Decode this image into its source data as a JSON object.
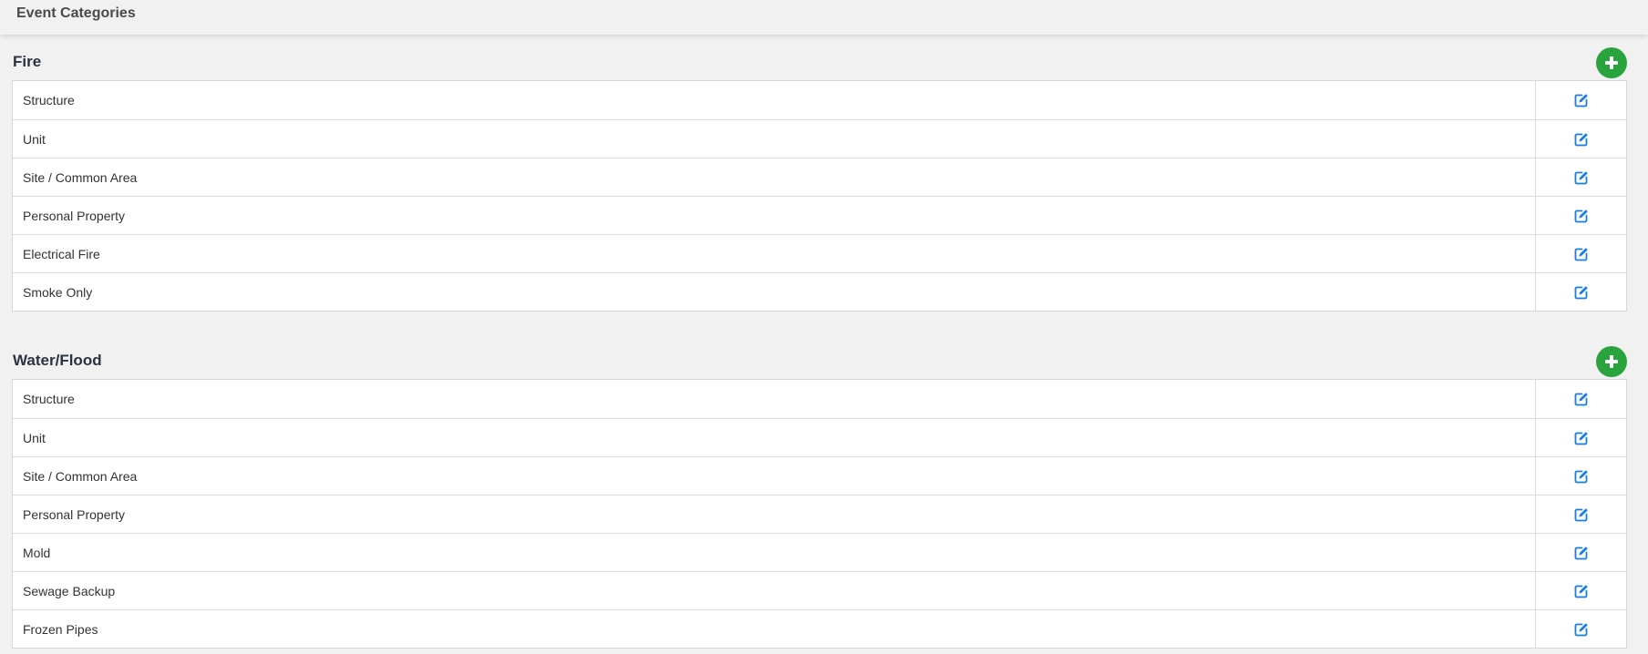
{
  "page": {
    "title": "Event Categories"
  },
  "colors": {
    "accent_blue": "#1a7ee8",
    "add_green": "#2aa33f"
  },
  "icons": {
    "add": "plus-icon",
    "edit": "edit-icon"
  },
  "groups": [
    {
      "title": "Fire",
      "items": [
        {
          "label": "Structure"
        },
        {
          "label": "Unit"
        },
        {
          "label": "Site / Common Area"
        },
        {
          "label": "Personal Property"
        },
        {
          "label": "Electrical Fire"
        },
        {
          "label": "Smoke Only"
        }
      ]
    },
    {
      "title": "Water/Flood",
      "items": [
        {
          "label": "Structure"
        },
        {
          "label": "Unit"
        },
        {
          "label": "Site / Common Area"
        },
        {
          "label": "Personal Property"
        },
        {
          "label": "Mold"
        },
        {
          "label": "Sewage Backup"
        },
        {
          "label": "Frozen Pipes"
        }
      ]
    }
  ]
}
